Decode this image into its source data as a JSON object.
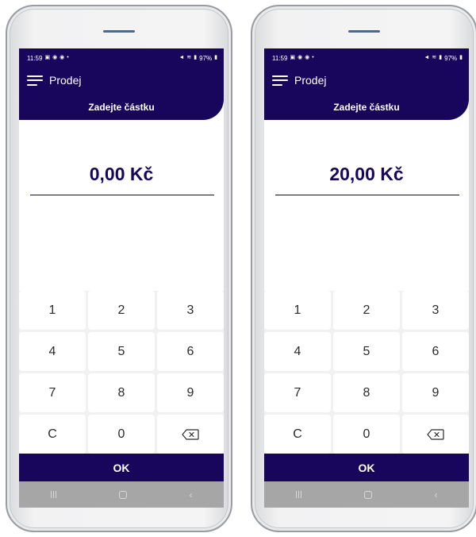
{
  "phones": [
    {
      "status": {
        "time": "11:59",
        "battery": "97%"
      },
      "app_title": "Prodej",
      "subtitle": "Zadejte částku",
      "amount": "0,00 Kč",
      "keys": [
        "1",
        "2",
        "3",
        "4",
        "5",
        "6",
        "7",
        "8",
        "9",
        "C",
        "0"
      ],
      "ok_label": "OK"
    },
    {
      "status": {
        "time": "11:59",
        "battery": "97%"
      },
      "app_title": "Prodej",
      "subtitle": "Zadejte částku",
      "amount": "20,00 Kč",
      "keys": [
        "1",
        "2",
        "3",
        "4",
        "5",
        "6",
        "7",
        "8",
        "9",
        "C",
        "0"
      ],
      "ok_label": "OK"
    }
  ],
  "icons": {
    "menu": "hamburger-icon",
    "backspace": "backspace-icon",
    "nav_recents": "recents-icon",
    "nav_home": "home-icon",
    "nav_back": "back-icon"
  },
  "colors": {
    "brand": "#17065b",
    "keypad_background": "#f1f1f1",
    "navbar": "#a6a6a6"
  }
}
